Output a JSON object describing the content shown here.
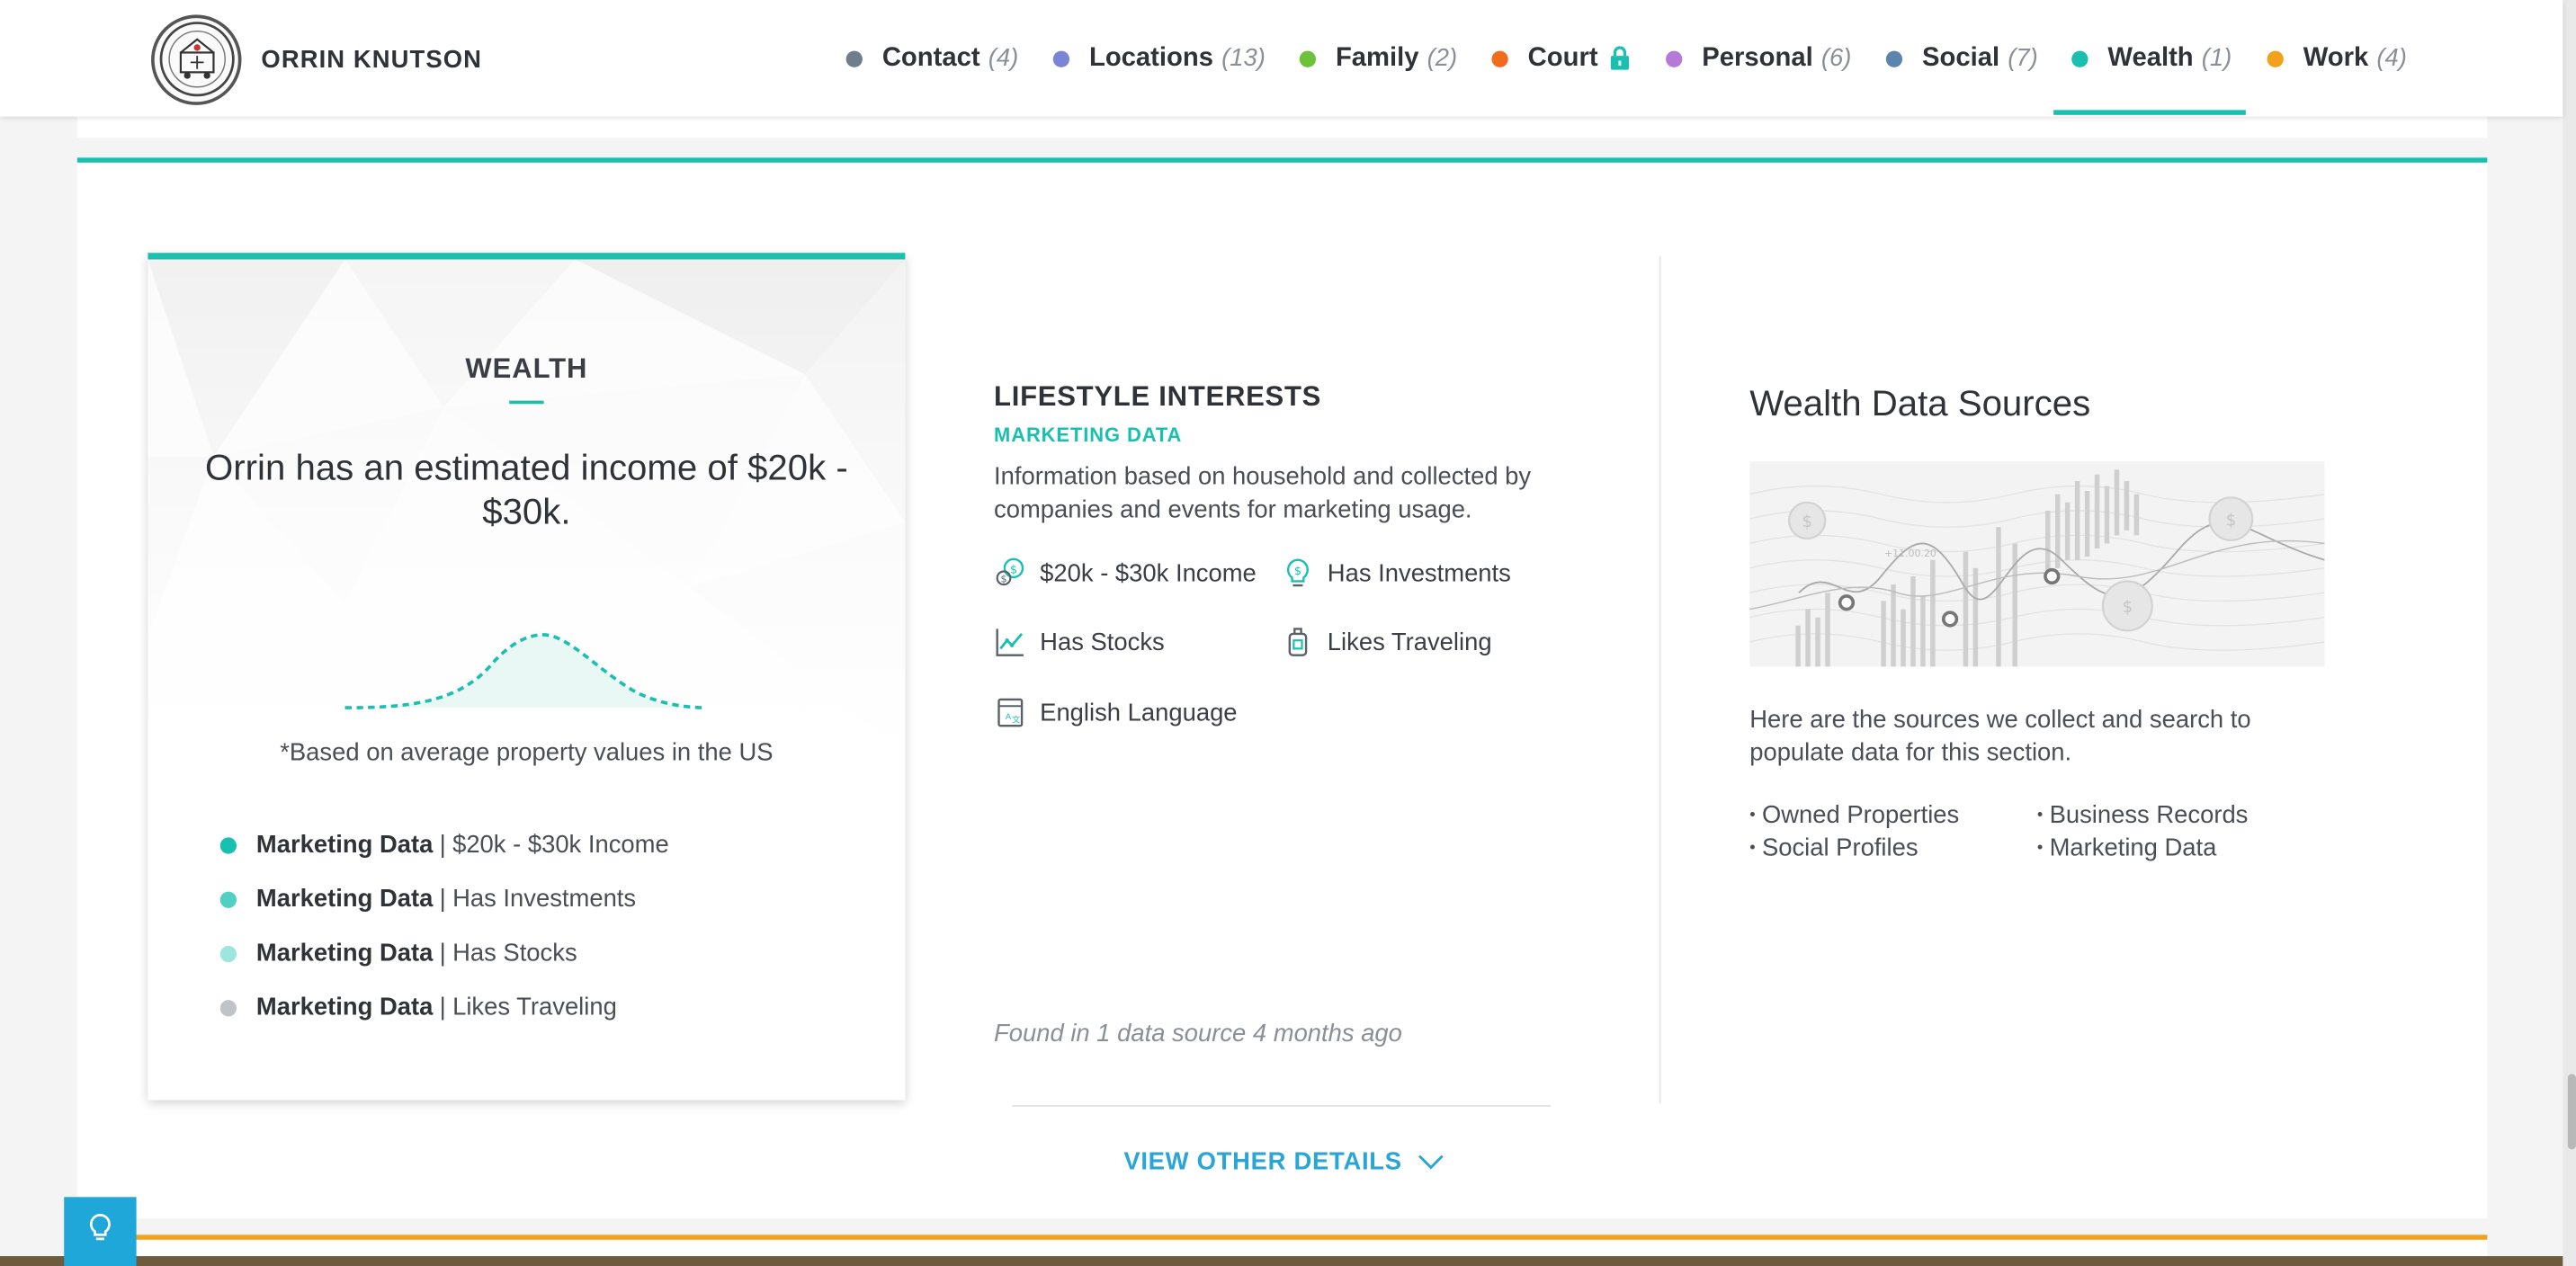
{
  "header": {
    "person_name": "ORRIN KNUTSON",
    "nav": [
      {
        "label": "Contact",
        "count": "(4)",
        "color": "#6f7e8c"
      },
      {
        "label": "Locations",
        "count": "(13)",
        "color": "#7a85d6"
      },
      {
        "label": "Family",
        "count": "(2)",
        "color": "#6cc23a"
      },
      {
        "label": "Court",
        "count": "",
        "color": "#f26b1d",
        "icon": "lock-icon"
      },
      {
        "label": "Personal",
        "count": "(6)",
        "color": "#b57ad8"
      },
      {
        "label": "Social",
        "count": "(7)",
        "color": "#5c85ad"
      },
      {
        "label": "Wealth",
        "count": "(1)",
        "color": "#19c0b0",
        "active": true
      },
      {
        "label": "Work",
        "count": "(4)",
        "color": "#f3a11a"
      }
    ]
  },
  "wealth_card": {
    "title": "WEALTH",
    "headline": "Orrin has an estimated income of $20k - $30k.",
    "note": "*Based on average property values in the US",
    "items": [
      {
        "source": "Marketing Data",
        "separator": "|",
        "value": "$20k - $30k Income",
        "color": "#19c0b0"
      },
      {
        "source": "Marketing Data",
        "separator": "|",
        "value": "Has Investments",
        "color": "#4fd0c2"
      },
      {
        "source": "Marketing Data",
        "separator": "|",
        "value": "Has Stocks",
        "color": "#9de6dd"
      },
      {
        "source": "Marketing Data",
        "separator": "|",
        "value": "Likes Traveling",
        "color": "#c0c4c8"
      }
    ]
  },
  "lifestyle": {
    "title": "LIFESTYLE INTERESTS",
    "subtitle": "MARKETING DATA",
    "description": "Information based on household and collected by companies and events for marketing usage.",
    "items": [
      {
        "label": "$20k - $30k Income",
        "icon": "money-hand-icon"
      },
      {
        "label": "Has Investments",
        "icon": "lightbulb-dollar-icon"
      },
      {
        "label": "Has Stocks",
        "icon": "stock-chart-icon"
      },
      {
        "label": "Likes Traveling",
        "icon": "luggage-icon"
      },
      {
        "label": "English Language",
        "icon": "language-book-icon"
      }
    ],
    "found": "Found in 1 data source 4 months ago",
    "view_other": "VIEW OTHER DETAILS"
  },
  "sources": {
    "title": "Wealth Data Sources",
    "description": "Here are the sources we collect and search to populate data for this section.",
    "list": [
      "Owned Properties",
      "Business Records",
      "Social Profiles",
      "Marketing Data"
    ]
  },
  "colors": {
    "accent": "#19c0b0",
    "link": "#2aa6d6",
    "help_button": "#1ea7d8",
    "work_strip": "#f3a11a"
  }
}
